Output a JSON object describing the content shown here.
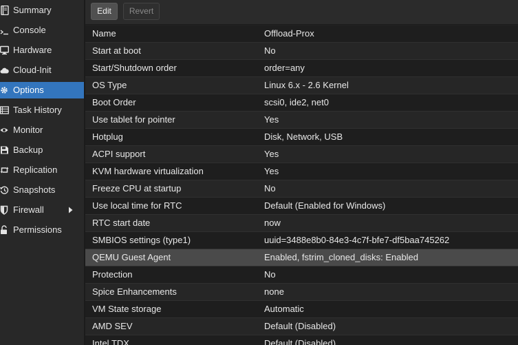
{
  "sidebar": {
    "items": [
      {
        "label": "Summary",
        "icon": "book-icon",
        "active": false
      },
      {
        "label": "Console",
        "icon": "terminal-icon",
        "active": false
      },
      {
        "label": "Hardware",
        "icon": "monitor-icon",
        "active": false
      },
      {
        "label": "Cloud-Init",
        "icon": "cloud-icon",
        "active": false
      },
      {
        "label": "Options",
        "icon": "gear-icon",
        "active": true
      },
      {
        "label": "Task History",
        "icon": "list-icon",
        "active": false
      },
      {
        "label": "Monitor",
        "icon": "eye-icon",
        "active": false
      },
      {
        "label": "Backup",
        "icon": "floppy-icon",
        "active": false
      },
      {
        "label": "Replication",
        "icon": "retweet-icon",
        "active": false
      },
      {
        "label": "Snapshots",
        "icon": "history-icon",
        "active": false
      },
      {
        "label": "Firewall",
        "icon": "shield-icon",
        "active": false,
        "has_submenu": true
      },
      {
        "label": "Permissions",
        "icon": "unlock-icon",
        "active": false
      }
    ]
  },
  "toolbar": {
    "edit_label": "Edit",
    "revert_label": "Revert"
  },
  "options": {
    "rows": [
      {
        "key": "Name",
        "value": "Offload-Prox"
      },
      {
        "key": "Start at boot",
        "value": "No"
      },
      {
        "key": "Start/Shutdown order",
        "value": "order=any"
      },
      {
        "key": "OS Type",
        "value": "Linux 6.x - 2.6 Kernel"
      },
      {
        "key": "Boot Order",
        "value": "scsi0, ide2, net0"
      },
      {
        "key": "Use tablet for pointer",
        "value": "Yes"
      },
      {
        "key": "Hotplug",
        "value": "Disk, Network, USB"
      },
      {
        "key": "ACPI support",
        "value": "Yes"
      },
      {
        "key": "KVM hardware virtualization",
        "value": "Yes"
      },
      {
        "key": "Freeze CPU at startup",
        "value": "No"
      },
      {
        "key": "Use local time for RTC",
        "value": "Default (Enabled for Windows)"
      },
      {
        "key": "RTC start date",
        "value": "now"
      },
      {
        "key": "SMBIOS settings (type1)",
        "value": "uuid=3488e8b0-84e3-4c7f-bfe7-df5baa745262"
      },
      {
        "key": "QEMU Guest Agent",
        "value": "Enabled, fstrim_cloned_disks: Enabled",
        "selected": true
      },
      {
        "key": "Protection",
        "value": "No"
      },
      {
        "key": "Spice Enhancements",
        "value": "none"
      },
      {
        "key": "VM State storage",
        "value": "Automatic"
      },
      {
        "key": "AMD SEV",
        "value": "Default (Disabled)"
      },
      {
        "key": "Intel TDX",
        "value": "Default (Disabled)"
      }
    ]
  },
  "colors": {
    "accent": "#3375bd",
    "selected_row": "#4a4a4a",
    "background": "#232323"
  }
}
